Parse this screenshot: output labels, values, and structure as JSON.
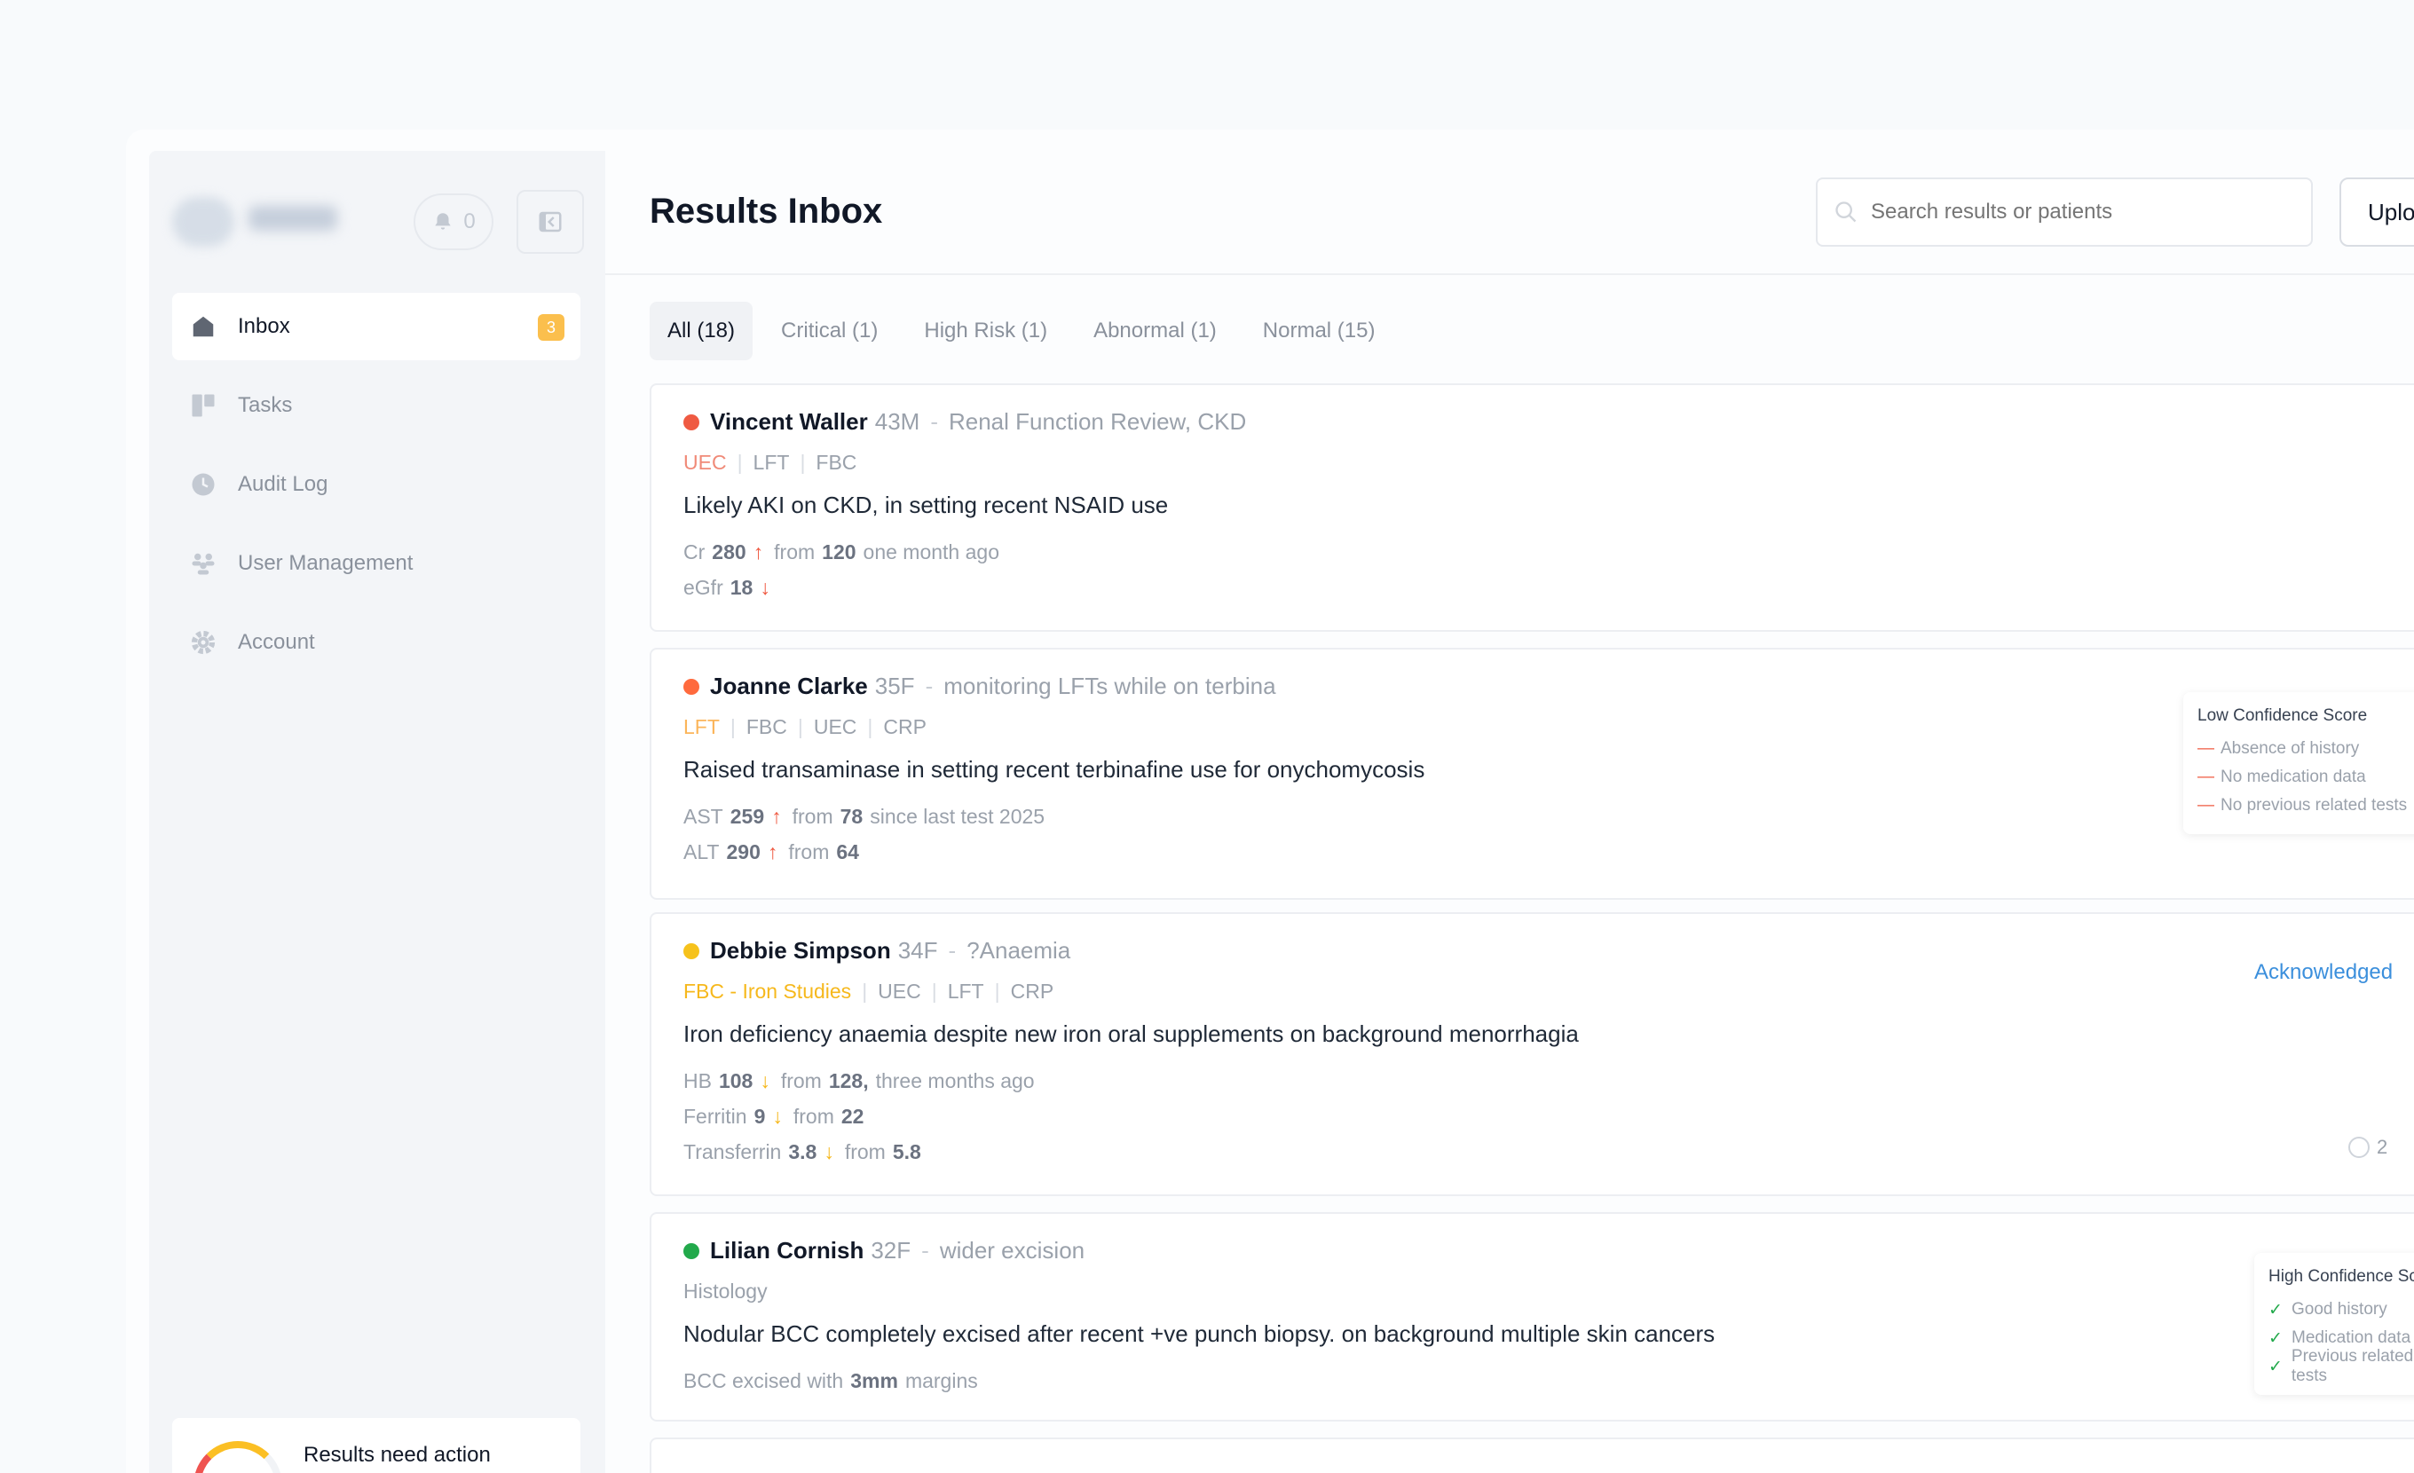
{
  "sidebar": {
    "brand": "",
    "notification_count": "0",
    "nav": [
      {
        "label": "Inbox",
        "badge": "3",
        "icon": "home-icon"
      },
      {
        "label": "Tasks",
        "icon": "kanban-icon"
      },
      {
        "label": "Audit Log",
        "icon": "clock-icon"
      },
      {
        "label": "User Management",
        "icon": "users-icon"
      },
      {
        "label": "Account",
        "icon": "gear-icon"
      }
    ],
    "footer_text": "Results need action"
  },
  "header": {
    "title": "Results Inbox",
    "search_placeholder": "Search results or patients",
    "upload_label": "Uplo"
  },
  "tabs": [
    {
      "label": "All (18)"
    },
    {
      "label": "Critical (1)"
    },
    {
      "label": "High Risk (1)"
    },
    {
      "label": "Abnormal (1)"
    },
    {
      "label": "Normal (15)"
    }
  ],
  "colors": {
    "critical": "#ef5a42",
    "high_risk": "#ff6a3d",
    "abnormal": "#f6c21c",
    "normal": "#22a94b",
    "accent_blue": "#3b8fdc"
  },
  "results": [
    {
      "name": "Vincent Waller",
      "age_sex": "43M",
      "reason": "Renal Function Review, CKD",
      "tests": [
        "UEC",
        "LFT",
        "FBC"
      ],
      "summary": "Likely AKI on CKD, in setting recent NSAID use",
      "values": [
        {
          "label": "Cr",
          "value": "280",
          "dir": "up",
          "from_text": "from",
          "from_value": "120",
          "suffix": "one month ago"
        },
        {
          "label": "eGfr",
          "value": "18",
          "dir": "down"
        }
      ]
    },
    {
      "name": "Joanne Clarke",
      "age_sex": "35F",
      "reason": "monitoring LFTs while on terbina",
      "tests": [
        "LFT",
        "FBC",
        "UEC",
        "CRP"
      ],
      "summary": "Raised transaminase in setting recent terbinafine use for onychomycosis",
      "values": [
        {
          "label": "AST",
          "value": "259",
          "dir": "up",
          "from_text": "from",
          "from_value": "78",
          "suffix": "since last test 2025"
        },
        {
          "label": "ALT",
          "value": "290",
          "dir": "up",
          "from_text": "from",
          "from_value": "64",
          "suffix": ""
        }
      ],
      "confidence": {
        "title": "Low Confidence Score",
        "items": [
          "Absence of history",
          "No medication data",
          "No previous related tests"
        ]
      }
    },
    {
      "name": "Debbie Simpson",
      "age_sex": "34F",
      "reason": "?Anaemia",
      "tests": [
        "FBC - Iron Studies",
        "UEC",
        "LFT",
        "CRP"
      ],
      "summary": "Iron deficiency anaemia despite new iron oral supplements on background menorrhagia",
      "status": "Acknowledged",
      "values": [
        {
          "label": "HB",
          "value": "108",
          "dir": "down",
          "from_text": "from",
          "from_value": "128,",
          "suffix": "three months ago"
        },
        {
          "label": "Ferritin",
          "value": "9",
          "dir": "down",
          "from_text": "from",
          "from_value": "22",
          "suffix": ""
        },
        {
          "label": "Transferrin",
          "value": "3.8",
          "dir": "down",
          "from_text": "from",
          "from_value": "5.8",
          "suffix": ""
        }
      ],
      "time_partial": "2"
    },
    {
      "name": "Lilian Cornish",
      "age_sex": "32F",
      "reason": "wider excision",
      "tests": [
        "Histology"
      ],
      "summary": "Nodular BCC completely excised after recent +ve punch biopsy. on background multiple skin cancers",
      "values_text": {
        "prefix": "BCC excised with",
        "bold": "3mm",
        "suffix": "margins"
      },
      "confidence": {
        "title": "High Confidence Score",
        "items": [
          "Good history",
          "Medication data",
          "Previous related tests"
        ]
      }
    }
  ]
}
